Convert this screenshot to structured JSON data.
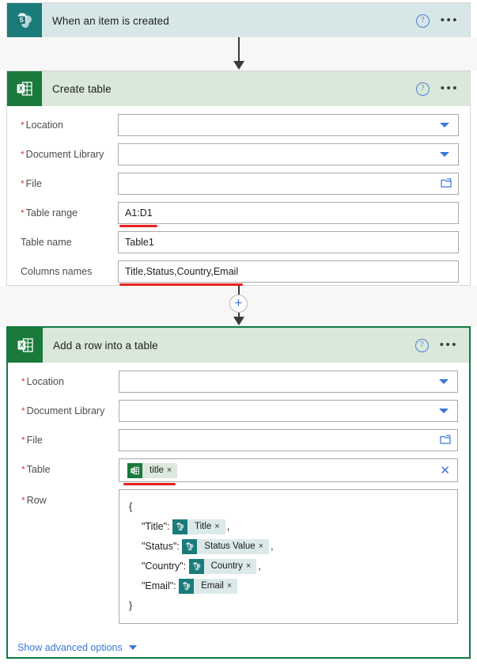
{
  "flow": {
    "trigger": {
      "title": "When an item is created",
      "icon": "sharepoint-icon",
      "help_label": "?",
      "more_label": "•••"
    },
    "actions": [
      {
        "id": "create-table",
        "title": "Create table",
        "icon": "excel-icon",
        "selected": false,
        "fields": [
          {
            "label": "Location",
            "required": true,
            "type": "dropdown",
            "value": "",
            "annotated": false
          },
          {
            "label": "Document Library",
            "required": true,
            "type": "dropdown",
            "value": "",
            "annotated": false
          },
          {
            "label": "File",
            "required": true,
            "type": "file-picker",
            "value": "",
            "annotated": false
          },
          {
            "label": "Table range",
            "required": true,
            "type": "text",
            "value": "A1:D1",
            "annotated": true
          },
          {
            "label": "Table name",
            "required": false,
            "type": "text",
            "value": "Table1",
            "annotated": false
          },
          {
            "label": "Columns names",
            "required": false,
            "type": "text",
            "value": "Title,Status,Country,Email",
            "annotated": true
          }
        ]
      },
      {
        "id": "add-a-row-into-a-table",
        "title": "Add a row into a table",
        "icon": "excel-icon",
        "selected": true,
        "fields": [
          {
            "label": "Location",
            "required": true,
            "type": "dropdown",
            "value": "",
            "annotated": false
          },
          {
            "label": "Document Library",
            "required": true,
            "type": "dropdown",
            "value": "",
            "annotated": false
          },
          {
            "label": "File",
            "required": true,
            "type": "file-picker",
            "value": "",
            "annotated": false
          },
          {
            "label": "Table",
            "required": true,
            "type": "token",
            "token": "title",
            "token_icon": "excel-icon",
            "annotated": true
          }
        ],
        "row_field": {
          "label": "Row",
          "required": true,
          "open_brace": "{",
          "close_brace": "}",
          "entries": [
            {
              "key": "\"Title\":",
              "token": "Title",
              "token_icon": "sharepoint-icon",
              "comma": ","
            },
            {
              "key": "\"Status\":",
              "token": "Status Value",
              "token_icon": "sharepoint-icon",
              "comma": ","
            },
            {
              "key": "\"Country\":",
              "token": "Country",
              "token_icon": "sharepoint-icon",
              "comma": ","
            },
            {
              "key": "\"Email\":",
              "token": "Email",
              "token_icon": "sharepoint-icon",
              "comma": ""
            }
          ]
        },
        "advanced_options_label": "Show advanced options"
      }
    ]
  },
  "icons": {
    "remove_token": "×",
    "clear_field": "✕",
    "add_step": "+",
    "folder": "◱"
  },
  "colors": {
    "sharepoint_teal": "#1b7b7b",
    "excel_green": "#1a7a3c",
    "header_sp_bg": "#d7e7e7",
    "header_xl_bg": "#d9e8d9",
    "selected_border": "#107c41",
    "link_blue": "#3a77d8",
    "annotation_red": "#e62020",
    "required_red": "#d93b36"
  }
}
